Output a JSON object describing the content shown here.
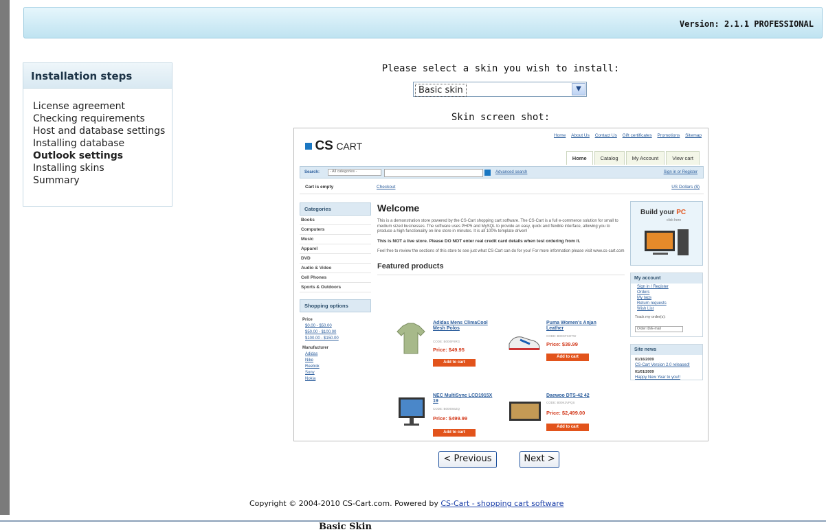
{
  "header": {
    "version_text": "Version: 2.1.1 PROFESSIONAL"
  },
  "steps": {
    "title": "Installation steps",
    "items": [
      {
        "label": "License agreement"
      },
      {
        "label": "Checking requirements"
      },
      {
        "label": "Host and database settings"
      },
      {
        "label": "Installing database"
      },
      {
        "label": "Outlook settings",
        "active": true
      },
      {
        "label": "Installing skins"
      },
      {
        "label": "Summary"
      }
    ]
  },
  "skin": {
    "select_label": "Please select a skin you wish to install:",
    "selected": "Basic skin",
    "screenshot_label": "Skin screen shot:"
  },
  "preview": {
    "top_links": [
      "Home",
      "About Us",
      "Contact Us",
      "Gift certificates",
      "Promotions",
      "Sitemap"
    ],
    "logo_cs": "CS",
    "logo_cart": "CART",
    "tabs": [
      {
        "label": "Home",
        "active": true
      },
      {
        "label": "Catalog"
      },
      {
        "label": "My Account"
      },
      {
        "label": "View cart"
      }
    ],
    "search_label": "Search:",
    "search_category": "- All categories -",
    "advanced_search": "Advanced search",
    "sign_in": "Sign in or Register",
    "cart_status": "Cart is empty",
    "checkout": "Checkout",
    "currency": "US Dollars ($)",
    "categories_title": "Categories",
    "categories": [
      "Books",
      "Computers",
      "Music",
      "Apparel",
      "DVD",
      "Audio & Video",
      "Cell Phones",
      "Sports & Outdoors"
    ],
    "shopping_options_title": "Shopping options",
    "price_title": "Price",
    "price_ranges": [
      "$0.00 - $50.00",
      "$50.00 - $100.00",
      "$100.00 - $150.00"
    ],
    "manufacturer_title": "Manufacturer",
    "manufacturers": [
      "Adidas",
      "Nike",
      "Reebok",
      "Sony",
      "Nokia"
    ],
    "welcome_title": "Welcome",
    "welcome_text": "This is a demonstration store powered by the CS-Cart shopping cart software. The CS-Cart is a full e-commerce solution for small to medium sized businesses. The software uses PHP5 and MySQL to provide an easy, quick and flexible interface, allowing you to produce a high functionality on-line store in minutes. It is all 100% template driven!",
    "warning_text": "This is NOT a live store. Please DO NOT enter real credit card details when test ordering from it.",
    "review_text": "Feel free to review the sections of this store to see just what CS-Cart can do for you! For more information please visit www.cs-cart.com",
    "featured_title": "Featured products",
    "products": [
      {
        "name": "Adidas Mens ClimaCool Mesh Polos",
        "code": "CODE: B00I0F8RG",
        "price": "Price: $49.95",
        "button": "Add to cart"
      },
      {
        "name": "Puma Women's Anjan Leather",
        "code": "CODE: B00GFSOTW",
        "price": "Price: $39.99",
        "button": "Add to cart"
      },
      {
        "name": "NEC MultiSync LCD1915X 19",
        "code": "CODE: B00I0S6ZQ",
        "price": "Price: $499.99",
        "button": "Add to cart"
      },
      {
        "name": "Daewoo DTS-42 42",
        "code": "CODE: B00K2VPQS",
        "price": "Price: $2,499.00",
        "button": "Add to cart"
      }
    ],
    "build_title_1": "Build your",
    "build_title_2": "PC",
    "build_click": "click here",
    "my_account_title": "My account",
    "account_links": [
      "Sign in / Register",
      "Orders",
      "My tags",
      "Return requests",
      "Wish List"
    ],
    "track_label": "Track my order(s):",
    "order_placeholder": "Order ID/E-mail",
    "site_news_title": "Site news",
    "news": [
      {
        "date": "01/16/2009",
        "title": "CS-Cart Version 2.0 released!"
      },
      {
        "date": "01/01/2009",
        "title": "Happy New Year to you!!"
      }
    ]
  },
  "nav": {
    "previous": "< Previous",
    "next": "Next >"
  },
  "footer": {
    "copyright": "Copyright © 2004-2010 CS-Cart.com. Powered by",
    "link": "CS-Cart - shopping cart software",
    "caption": "Basic Skin"
  }
}
